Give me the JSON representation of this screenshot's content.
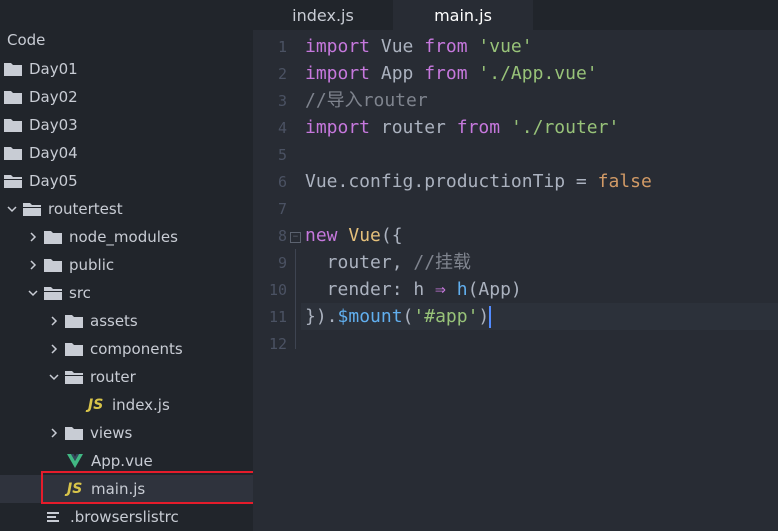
{
  "tabs": [
    {
      "label": "index.js",
      "active": false
    },
    {
      "label": "main.js",
      "active": true
    }
  ],
  "sidebar": {
    "title": "Code",
    "items": [
      {
        "label": "Day01",
        "type": "folder"
      },
      {
        "label": "Day02",
        "type": "folder"
      },
      {
        "label": "Day03",
        "type": "folder"
      },
      {
        "label": "Day04",
        "type": "folder"
      },
      {
        "label": "Day05",
        "type": "folder-open"
      },
      {
        "label": "routertest",
        "type": "folder-open"
      },
      {
        "label": "node_modules",
        "type": "folder"
      },
      {
        "label": "public",
        "type": "folder"
      },
      {
        "label": "src",
        "type": "folder-open"
      },
      {
        "label": "assets",
        "type": "folder"
      },
      {
        "label": "components",
        "type": "folder"
      },
      {
        "label": "router",
        "type": "folder-open"
      },
      {
        "label": "index.js",
        "type": "js-file"
      },
      {
        "label": "views",
        "type": "folder"
      },
      {
        "label": "App.vue",
        "type": "vue-file"
      },
      {
        "label": "main.js",
        "type": "js-file",
        "selected": true
      },
      {
        "label": ".browserslistrc",
        "type": "config-file"
      }
    ]
  },
  "editor": {
    "line_numbers": [
      "1",
      "2",
      "3",
      "4",
      "5",
      "6",
      "7",
      "8",
      "9",
      "10",
      "11",
      "12"
    ],
    "lines": [
      [
        {
          "t": "import",
          "c": "kw"
        },
        {
          "t": " Vue ",
          "c": "plain"
        },
        {
          "t": "from",
          "c": "kw"
        },
        {
          "t": " ",
          "c": "plain"
        },
        {
          "t": "'vue'",
          "c": "str"
        }
      ],
      [
        {
          "t": "import",
          "c": "kw"
        },
        {
          "t": " App ",
          "c": "plain"
        },
        {
          "t": "from",
          "c": "kw"
        },
        {
          "t": " ",
          "c": "plain"
        },
        {
          "t": "'./App.vue'",
          "c": "str"
        }
      ],
      [
        {
          "t": "//导入router",
          "c": "cm"
        }
      ],
      [
        {
          "t": "import",
          "c": "kw"
        },
        {
          "t": " router ",
          "c": "plain"
        },
        {
          "t": "from",
          "c": "kw"
        },
        {
          "t": " ",
          "c": "plain"
        },
        {
          "t": "'./router'",
          "c": "str"
        }
      ],
      [],
      [
        {
          "t": "Vue.config.productionTip = ",
          "c": "plain"
        },
        {
          "t": "false",
          "c": "bool"
        }
      ],
      [],
      [
        {
          "t": "new",
          "c": "kw"
        },
        {
          "t": " ",
          "c": "plain"
        },
        {
          "t": "Vue",
          "c": "cls"
        },
        {
          "t": "({",
          "c": "plain"
        }
      ],
      [
        {
          "t": "  router, ",
          "c": "plain"
        },
        {
          "t": "//挂载",
          "c": "cm"
        }
      ],
      [
        {
          "t": "  render: h ",
          "c": "plain"
        },
        {
          "t": "⇒",
          "c": "kw"
        },
        {
          "t": " ",
          "c": "plain"
        },
        {
          "t": "h",
          "c": "fn"
        },
        {
          "t": "(App)",
          "c": "plain"
        }
      ],
      [
        {
          "t": "}).",
          "c": "plain"
        },
        {
          "t": "$mount",
          "c": "fn"
        },
        {
          "t": "(",
          "c": "plain"
        },
        {
          "t": "'#app'",
          "c": "str"
        },
        {
          "t": ")",
          "c": "plain"
        }
      ],
      []
    ]
  },
  "colors": {
    "keyword": "#c678dd",
    "string": "#98c379",
    "comment": "#7f848e",
    "class": "#e5c07b",
    "function": "#61afef",
    "boolean": "#d19a66",
    "highlight_box": "#e51c2b"
  }
}
